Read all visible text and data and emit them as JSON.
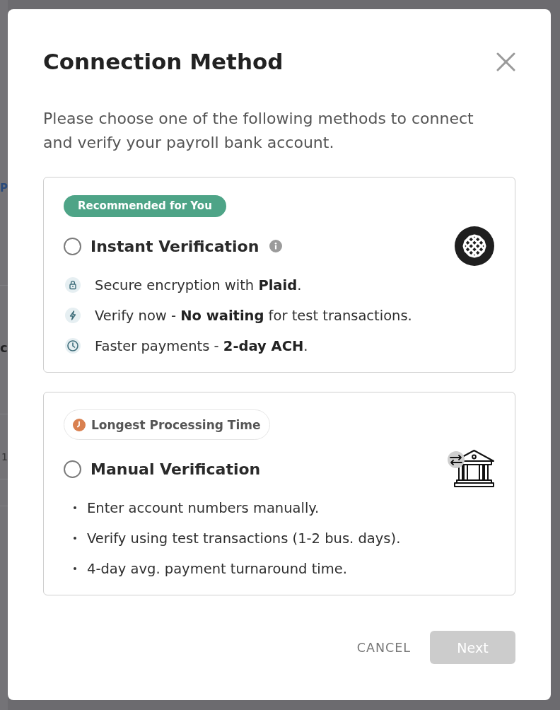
{
  "background_page": {
    "fragments": [
      {
        "kind": "link",
        "text": "P"
      },
      {
        "kind": "heading",
        "text": "c"
      },
      {
        "kind": "cell",
        "text": "1"
      }
    ]
  },
  "dialog": {
    "title": "Connection Method",
    "description": "Please choose one of the following methods to connect and verify your payroll bank account.",
    "options": [
      {
        "kind": "instant",
        "badge": "Recommended for You",
        "title": "Instant Verification",
        "selected": false,
        "info": true,
        "features": [
          "Secure encryption with **Plaid**.",
          "Verify now - **No waiting** for test transactions.",
          "Faster payments - **2-day ACH**."
        ]
      },
      {
        "kind": "manual",
        "badge": "Longest Processing Time",
        "title": "Manual Verification",
        "selected": false,
        "info": false,
        "features": [
          "Enter account numbers manually.",
          "Verify using test transactions (1-2 bus. days).",
          "4-day avg. payment turnaround time."
        ]
      }
    ],
    "buttons": [
      {
        "kind": "text",
        "label": "CANCEL",
        "disabled": false
      },
      {
        "kind": "primary",
        "label": "Next",
        "disabled": true
      }
    ]
  }
}
